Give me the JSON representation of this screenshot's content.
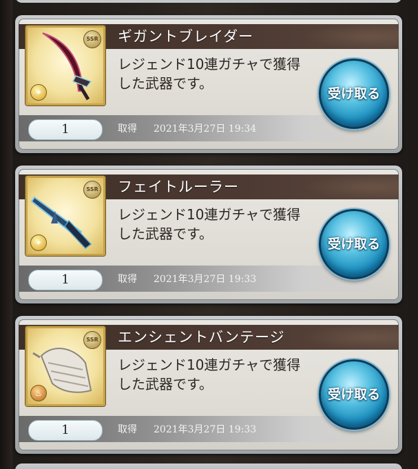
{
  "items": [
    {
      "name": "ギガントブレイダー",
      "rarity": "SSR",
      "element": "light",
      "element_icon": "light-element-icon",
      "description": "レジェンド10連ガチャで獲得した武器です。",
      "quantity": "1",
      "acquired_label": "取得",
      "acquired_date": "2021年3月27日  19:34",
      "receive_label": "受け取る"
    },
    {
      "name": "フェイトルーラー",
      "rarity": "SSR",
      "element": "light",
      "element_icon": "light-element-icon",
      "description": "レジェンド10連ガチャで獲得した武器です。",
      "quantity": "1",
      "acquired_label": "取得",
      "acquired_date": "2021年3月27日  19:33",
      "receive_label": "受け取る"
    },
    {
      "name": "エンシェントバンテージ",
      "rarity": "SSR",
      "element": "fire",
      "element_icon": "fire-element-icon",
      "description": "レジェンド10連ガチャで獲得した武器です。",
      "quantity": "1",
      "acquired_label": "取得",
      "acquired_date": "2021年3月27日  19:33",
      "receive_label": "受け取る"
    }
  ],
  "colors": {
    "title_bar": "#4d3a32",
    "receive_button": "#1d8fbf",
    "frame_gold": "#c7a24a"
  }
}
